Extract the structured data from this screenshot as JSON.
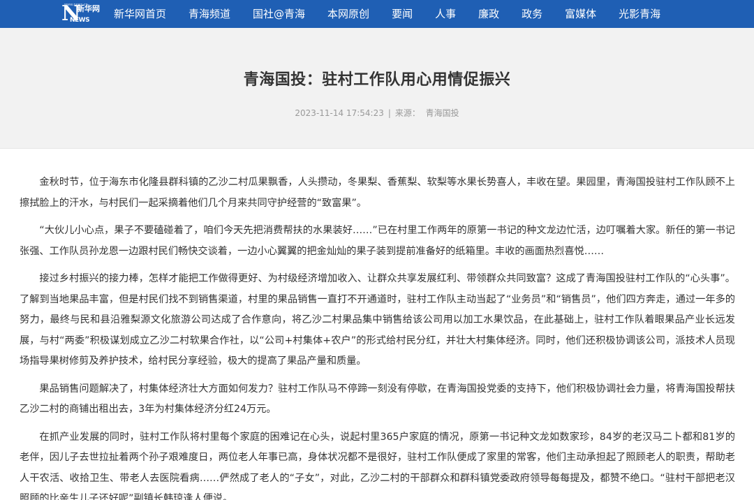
{
  "nav": {
    "logo": {
      "text": "N",
      "chinese": "新华网",
      "english": "NEWS",
      "url": "www.news.cn"
    },
    "items": [
      {
        "label": "新华网首页"
      },
      {
        "label": "青海频道"
      },
      {
        "label": "国社@青海"
      },
      {
        "label": "本网原创"
      },
      {
        "label": "要闻"
      },
      {
        "label": "人事"
      },
      {
        "label": "廉政"
      },
      {
        "label": "政务"
      },
      {
        "label": "富媒体"
      },
      {
        "label": "光影青海"
      }
    ],
    "colors": {
      "background": "#1f5fb4",
      "text": "#ffffff"
    }
  },
  "article": {
    "title": "青海国投：驻村工作队用心用情促振兴",
    "timestamp": "2023-11-14 17:54:23",
    "separator": "|",
    "source_label": "来源：",
    "source": "青海国投",
    "paragraphs": [
      "金秋时节，位于海东市化隆县群科镇的乙沙二村瓜果飘香，人头攒动，冬果梨、香蕉梨、软梨等水果长势喜人，丰收在望。果园里，青海国投驻村工作队顾不上擦拭脸上的汗水，与村民们一起采摘着他们几个月来共同守护经营的“致富果”。",
      "“大伙儿小心点，果子不要磕碰着了，咱们今天先把消费帮扶的水果装好……”已在村里工作两年的原第一书记的种文龙边忙活，边叮嘱着大家。新任的第一书记张强、工作队员孙龙恩一边跟村民们畅快交谈着，一边小心翼翼的把金灿灿的果子装到提前准备好的纸箱里。丰收的画面热烈喜悦……",
      "接过乡村振兴的接力棒，怎样才能把工作做得更好、为村级经济增加收入、让群众共享发展红利、带领群众共同致富？这成了青海国投驻村工作队的“心头事”。了解到当地果品丰富，但是村民们找不到销售渠道，村里的果品销售一直打不开通道时，驻村工作队主动当起了“业务员”和“销售员”，他们四方奔走，通过一年多的努力，最终与民和县沿雅梨源文化旅游公司达成了合作意向，将乙沙二村果品集中销售给该公司用以加工水果饮品，在此基础上，驻村工作队着眼果品产业长远发展，与村“两委”积极谋划成立乙沙二村软果合作社，以“公司+村集体+农户”的形式给村民分红，并壮大村集体经济。同时，他们还积极协调该公司，派技术人员现场指导果树修剪及养护技术，给村民分享经验，极大的提高了果品产量和质量。",
      "果品销售问题解决了，村集体经济壮大方面如何发力？驻村工作队马不停蹄一刻没有停歇，在青海国投党委的支持下，他们积极协调社会力量，将青海国投帮扶乙沙二村的商铺出租出去，3年为村集体经济分红24万元。",
      "在抓产业发展的同时，驻村工作队将村里每个家庭的困难记在心头，说起村里365户家庭的情况，原第一书记种文龙如数家珍，84岁的老汉马二卜都和81岁的老伴，因儿子去世拉扯着两个孙子艰难度日，两位老人年事已高，身体状况都不是很好，驻村工作队便成了家里的常客，他们主动承担起了照顾老人的职责，帮助老人干农活、收拾卫生、带老人去医院看病……俨然成了老人的“子女”，对此，乙沙二村的干部群众和群科镇党委政府领导每每提及，都赞不绝口。“驻村干部把老汉照顾的比亲生儿子还好呢”副镇长韩琼逢人便说。"
    ]
  }
}
